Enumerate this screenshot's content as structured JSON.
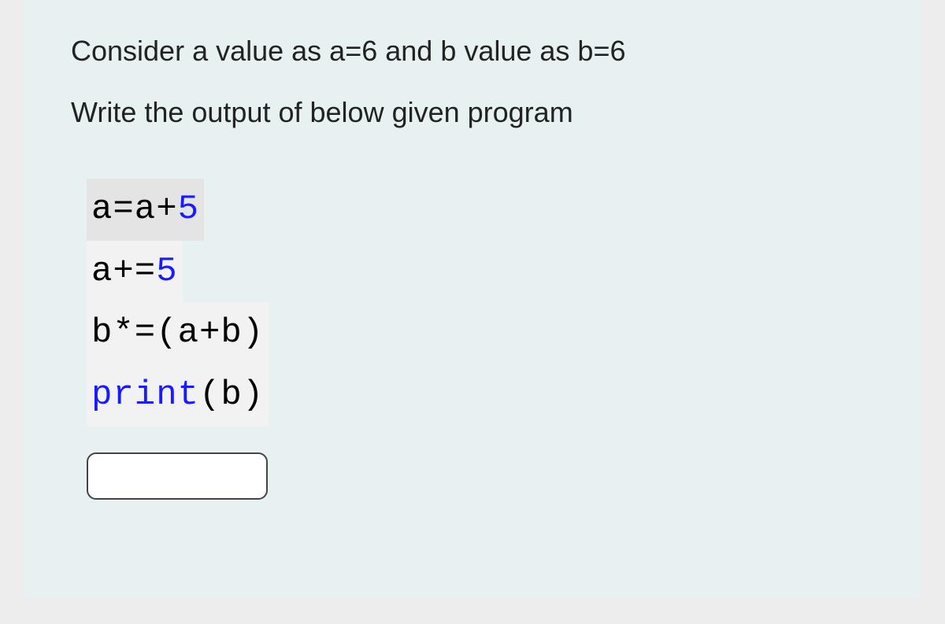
{
  "question": {
    "line1": "Consider a value as a=6 and b value as b=6",
    "line2": "Write the output of below given program"
  },
  "code": {
    "line1": {
      "pre": "a=a+",
      "num": "5"
    },
    "line2": {
      "pre": "a+=",
      "num": "5"
    },
    "line3": {
      "pre": "b*=(a+b)"
    },
    "line4": {
      "func": "print",
      "rest": "(b)"
    }
  },
  "answer": {
    "value": "",
    "placeholder": ""
  }
}
